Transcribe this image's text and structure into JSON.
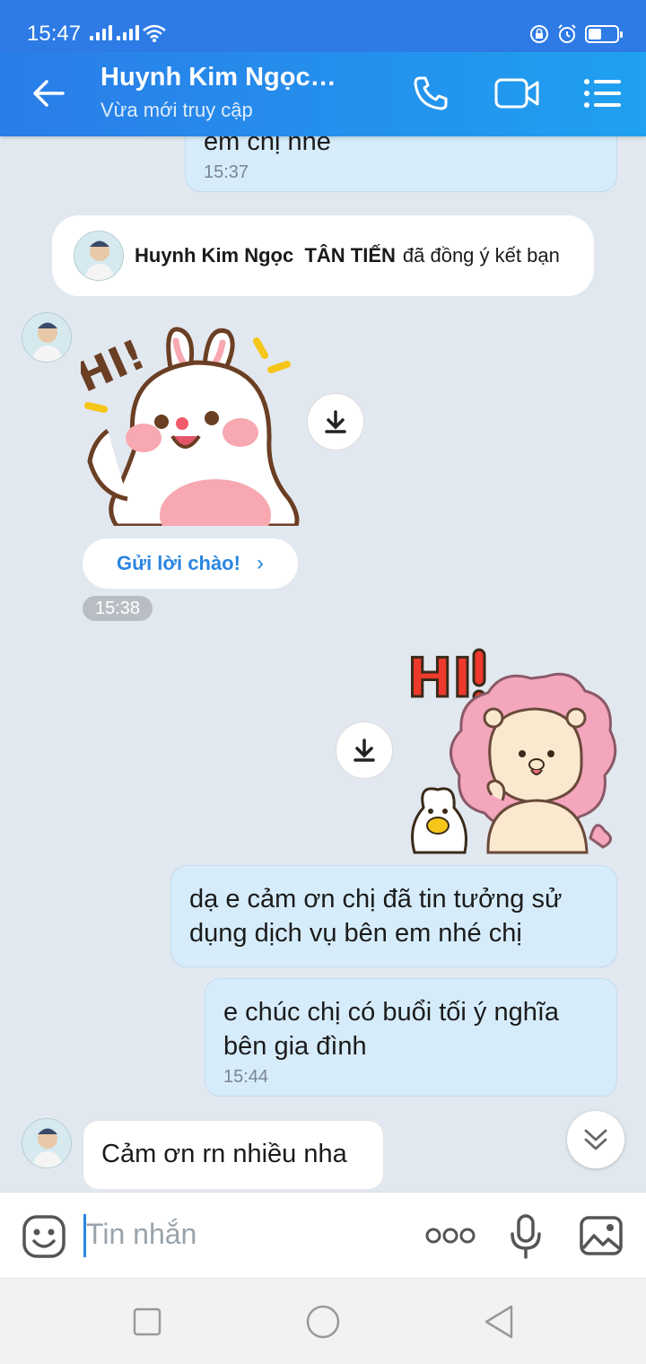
{
  "status": {
    "time": "15:47"
  },
  "header": {
    "title": "Huynh Kim Ngọc…",
    "subtitle": "Vừa mới truy cập"
  },
  "messages": {
    "top_partial": {
      "text": "em chị nhé",
      "time": "15:37"
    },
    "friend_banner": {
      "name": "Huynh Kim Ngọc  TÂN TIẾN",
      "action": "đã đồng ý kết bạn"
    },
    "greet_button": "Gửi lời chào!",
    "sticker_time": "15:38",
    "out1": {
      "text": "dạ e cảm ơn chị đã tin tưởng sử\ndụng dịch vụ bên em nhé chị"
    },
    "out2": {
      "text": "e chúc chị có buổi tối ý nghĩa\nbên gia đình",
      "time": "15:44"
    },
    "in1": {
      "text": "Cảm ơn rn nhiều nha"
    }
  },
  "input": {
    "placeholder": "Tin nhắn"
  },
  "colors": {
    "header_start": "#2a7de8",
    "header_end": "#1fa0f0",
    "out_bubble": "#d6ecfb",
    "chat_bg": "#e2e8f0",
    "accent": "#2a86e0"
  }
}
